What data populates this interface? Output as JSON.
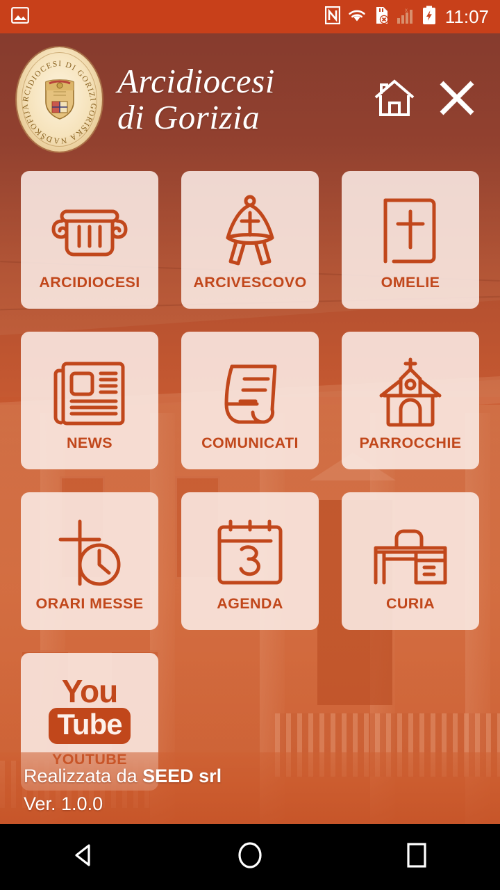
{
  "status_bar": {
    "time": "11:07",
    "icons": [
      "image-icon",
      "nfc-icon",
      "wifi-icon",
      "sd-card-error-icon",
      "signal-bars-icon",
      "battery-charging-icon"
    ],
    "background_color": "#c8401a"
  },
  "header": {
    "title_line1": "Arcidiocesi",
    "title_line2": "di Gorizia",
    "logo": {
      "name": "arcidiocesi-di-gorizia-crest",
      "top_arc_text": "ARCIDIOCESI DI GORIZIA",
      "bottom_arc_text": "GORIŠKA NADŠKOFIJA"
    },
    "home_button_label": "home-icon",
    "close_button_label": "close-icon"
  },
  "menu": {
    "items": [
      {
        "label": "ARCIDIOCESI",
        "icon": "column-capital-icon"
      },
      {
        "label": "ARCIVESCOVO",
        "icon": "bishop-mitre-icon"
      },
      {
        "label": "OMELIE",
        "icon": "bible-cross-icon"
      },
      {
        "label": "NEWS",
        "icon": "newspaper-icon"
      },
      {
        "label": "COMUNICATI",
        "icon": "document-scroll-icon"
      },
      {
        "label": "PARROCCHIE",
        "icon": "church-icon"
      },
      {
        "label": "ORARI MESSE",
        "icon": "cross-clock-icon"
      },
      {
        "label": "AGENDA",
        "icon": "calendar-3-icon"
      },
      {
        "label": "CURIA",
        "icon": "desk-icon"
      },
      {
        "label": "YOUTUBE",
        "icon": "youtube-logo"
      }
    ],
    "youtube_logo_text_1": "You",
    "youtube_logo_text_2": "Tube"
  },
  "footer": {
    "credit_prefix": "Realizzata da ",
    "credit_company": "SEED srl",
    "version": "Ver. 1.0.0"
  },
  "navigation_bar": {
    "back_label": "back-icon",
    "home_label": "home-icon",
    "recents_label": "recents-icon"
  },
  "theme": {
    "accent": "#c1471b",
    "status_bar": "#c8401a",
    "tile_background": "#faece6",
    "header_overlay": "#8d3c2c"
  }
}
